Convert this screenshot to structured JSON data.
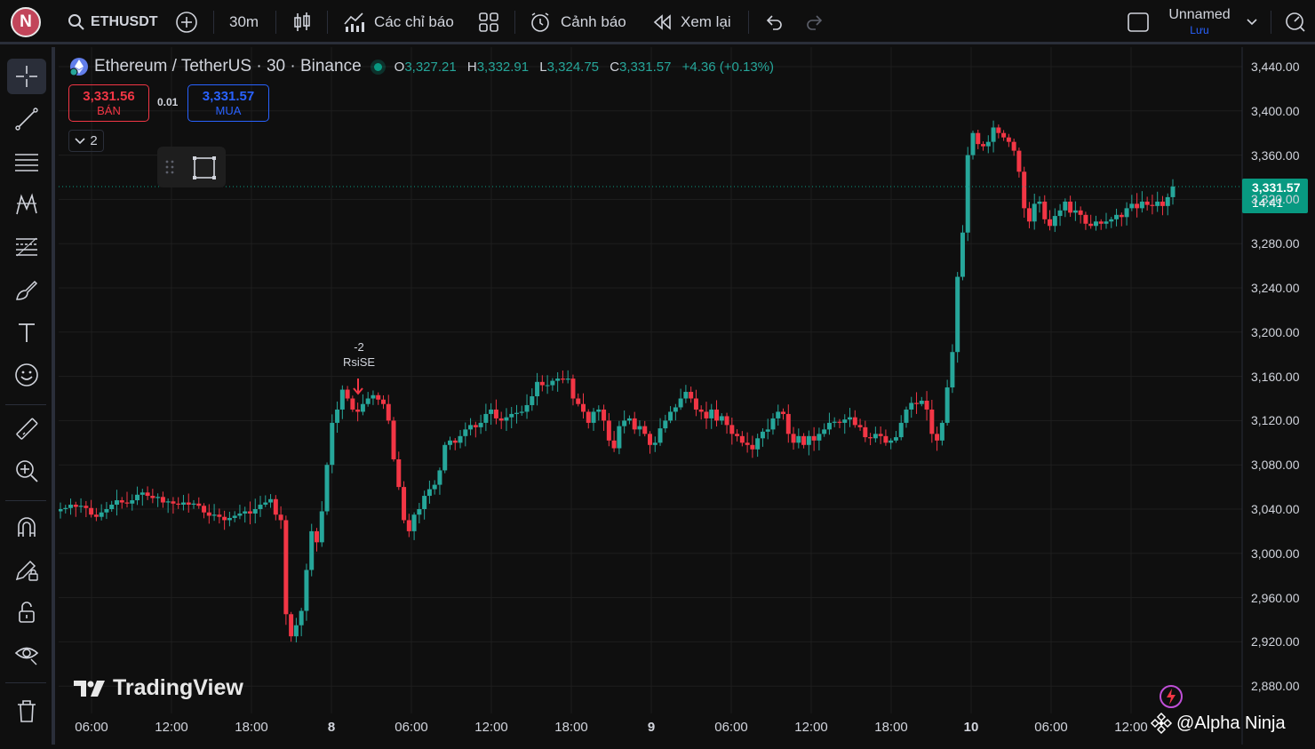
{
  "app": {
    "avatar_letter": "N"
  },
  "toolbar": {
    "symbol": "ETHUSDT",
    "interval": "30m",
    "indicators_label": "Các chỉ báo",
    "alerts_label": "Cảnh báo",
    "replay_label": "Xem lại",
    "layout_name": "Unnamed",
    "save_label": "Lưu"
  },
  "legend": {
    "title": "Ethereum / TetherUS · 30 · Binance",
    "o_key": "O",
    "o": "3,327.21",
    "h_key": "H",
    "h": "3,332.91",
    "l_key": "L",
    "l": "3,324.75",
    "c_key": "C",
    "c": "3,331.57",
    "change": "+4.36 (+0.13%)"
  },
  "trade": {
    "sell_price": "3,331.56",
    "sell_label": "BÁN",
    "spread": "0.01",
    "buy_price": "3,331.57",
    "buy_label": "MUA",
    "collapse_count": "2"
  },
  "annotation": {
    "line1": "-2",
    "line2": "RsiSE"
  },
  "last_price": {
    "price": "3,331.57",
    "countdown": "14:41"
  },
  "watermark": "TradingView",
  "overlay_text": "@Alpha Ninja",
  "colors": {
    "up": "#26a69a",
    "down": "#f23645",
    "bg": "#0f0f0f",
    "grid": "#1e1e1e",
    "last": "#089981"
  },
  "chart_data": {
    "type": "candlestick",
    "symbol": "ETHUSDT",
    "x_ticks": [
      "06:00",
      "12:00",
      "18:00",
      "8",
      "06:00",
      "12:00",
      "18:00",
      "9",
      "06:00",
      "12:00",
      "18:00",
      "10",
      "06:00",
      "12:00"
    ],
    "y_ticks": [
      "3,440.00",
      "3,400.00",
      "3,360.00",
      "3,320.00",
      "3,280.00",
      "3,240.00",
      "3,200.00",
      "3,160.00",
      "3,120.00",
      "3,080.00",
      "3,040.00",
      "3,000.00",
      "2,960.00",
      "2,920.00",
      "2,880.00"
    ],
    "ylim": [
      2875,
      3445
    ],
    "close_series": [
      3040,
      3041,
      3044,
      3042,
      3043,
      3041,
      3035,
      3033,
      3037,
      3040,
      3044,
      3048,
      3046,
      3045,
      3048,
      3053,
      3055,
      3052,
      3050,
      3051,
      3046,
      3047,
      3045,
      3044,
      3046,
      3044,
      3045,
      3043,
      3037,
      3034,
      3035,
      3033,
      3030,
      3032,
      3034,
      3036,
      3038,
      3036,
      3040,
      3044,
      3046,
      3049,
      3035,
      3030,
      2945,
      2925,
      2935,
      2948,
      2985,
      3020,
      3010,
      3038,
      3080,
      3118,
      3130,
      3148,
      3140,
      3130,
      3128,
      3135,
      3140,
      3143,
      3139,
      3135,
      3120,
      3085,
      3060,
      3030,
      3020,
      3035,
      3040,
      3052,
      3058,
      3062,
      3075,
      3098,
      3102,
      3100,
      3106,
      3112,
      3116,
      3114,
      3118,
      3126,
      3130,
      3122,
      3120,
      3123,
      3126,
      3127,
      3128,
      3134,
      3142,
      3155,
      3152,
      3152,
      3156,
      3158,
      3157,
      3158,
      3140,
      3135,
      3128,
      3118,
      3128,
      3130,
      3120,
      3102,
      3095,
      3115,
      3120,
      3122,
      3112,
      3115,
      3108,
      3098,
      3100,
      3113,
      3120,
      3128,
      3132,
      3140,
      3146,
      3140,
      3130,
      3128,
      3122,
      3130,
      3120,
      3124,
      3116,
      3108,
      3106,
      3100,
      3098,
      3094,
      3104,
      3110,
      3112,
      3122,
      3128,
      3126,
      3108,
      3100,
      3106,
      3098,
      3106,
      3102,
      3108,
      3112,
      3118,
      3119,
      3118,
      3121,
      3123,
      3116,
      3114,
      3105,
      3104,
      3108,
      3106,
      3100,
      3102,
      3105,
      3118,
      3130,
      3136,
      3135,
      3138,
      3130,
      3108,
      3102,
      3118,
      3150,
      3182,
      3250,
      3290,
      3360,
      3380,
      3370,
      3368,
      3372,
      3385,
      3380,
      3376,
      3372,
      3364,
      3345,
      3312,
      3300,
      3316,
      3318,
      3302,
      3296,
      3305,
      3310,
      3318,
      3308,
      3310,
      3306,
      3298,
      3296,
      3300,
      3298,
      3300,
      3302,
      3306,
      3304,
      3312,
      3316,
      3312,
      3318,
      3315,
      3314,
      3318,
      3314,
      3322,
      3331.57
    ],
    "last_price": 3331.57
  }
}
